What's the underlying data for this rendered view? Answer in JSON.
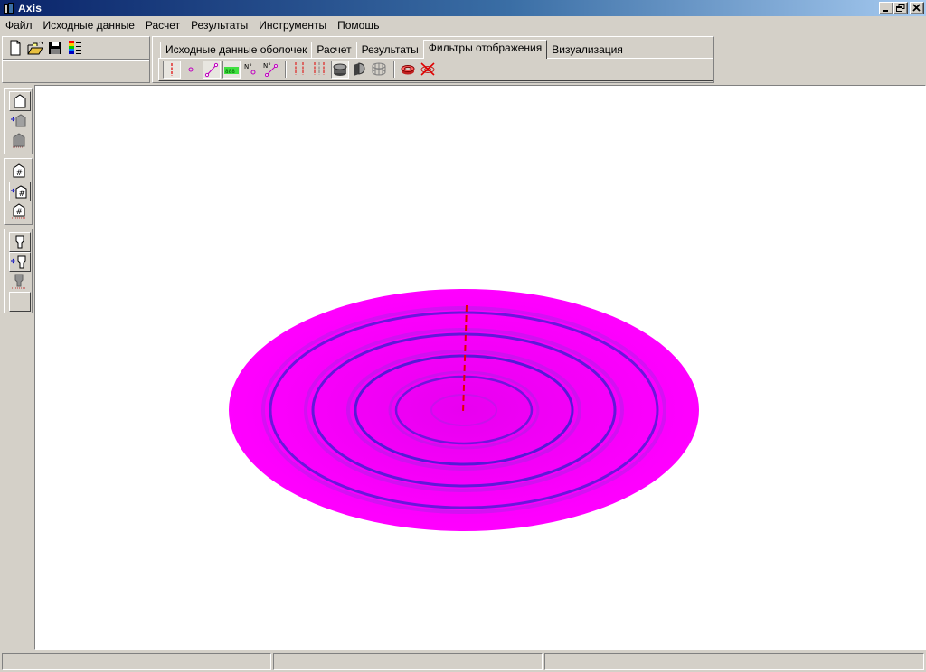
{
  "window": {
    "title": "Axis",
    "buttons": [
      "minimize",
      "restore",
      "close"
    ]
  },
  "menu": [
    "Файл",
    "Исходные данные",
    "Расчет",
    "Результаты",
    "Инструменты",
    "Помощь"
  ],
  "tabs": [
    {
      "label": "Исходные данные оболочек",
      "active": false
    },
    {
      "label": "Расчет",
      "active": false
    },
    {
      "label": "Результаты",
      "active": false
    },
    {
      "label": "Фильтры отображения",
      "active": true
    },
    {
      "label": "Визуализация",
      "active": false
    }
  ],
  "file_toolbar": [
    "new-document-icon",
    "open-folder-icon",
    "save-disk-icon",
    "color-palette-icon"
  ],
  "filter_tools": [
    {
      "icon": "axis-line-icon",
      "pressed": true
    },
    {
      "icon": "nodes-icon",
      "pressed": false
    },
    {
      "icon": "elements-icon",
      "pressed": true
    },
    {
      "icon": "mesh-numbers-icon",
      "pressed": true
    },
    {
      "icon": "node-numbers-icon",
      "pressed": false
    },
    {
      "icon": "element-numbers-icon",
      "pressed": false
    },
    {
      "icon": "axis-lines-single-icon",
      "pressed": false
    },
    {
      "icon": "axis-lines-double-icon",
      "pressed": false
    },
    {
      "icon": "shell-solid-icon",
      "pressed": true
    },
    {
      "icon": "shell-section-icon",
      "pressed": false
    },
    {
      "icon": "shell-wire-icon",
      "pressed": false
    },
    {
      "icon": "ring-icon",
      "pressed": false
    },
    {
      "icon": "ring-disabled-icon",
      "pressed": false
    }
  ],
  "sidebar_groups": [
    [
      "shell-outline-icon",
      "shell-import-icon",
      "shell-solid-icon"
    ],
    [
      "mesh-shell-icon",
      "mesh-import-icon",
      "mesh-fixed-icon"
    ],
    [
      "support-outline-icon",
      "support-import-icon",
      "support-solid-icon",
      "empty-slot"
    ]
  ],
  "colors": {
    "plate": "#ff00ff",
    "rings": "#3a1fd0",
    "axis": "#e00000",
    "titlebar_start": "#0a246a",
    "titlebar_end": "#a6caf0"
  },
  "status": [
    "",
    "",
    ""
  ]
}
